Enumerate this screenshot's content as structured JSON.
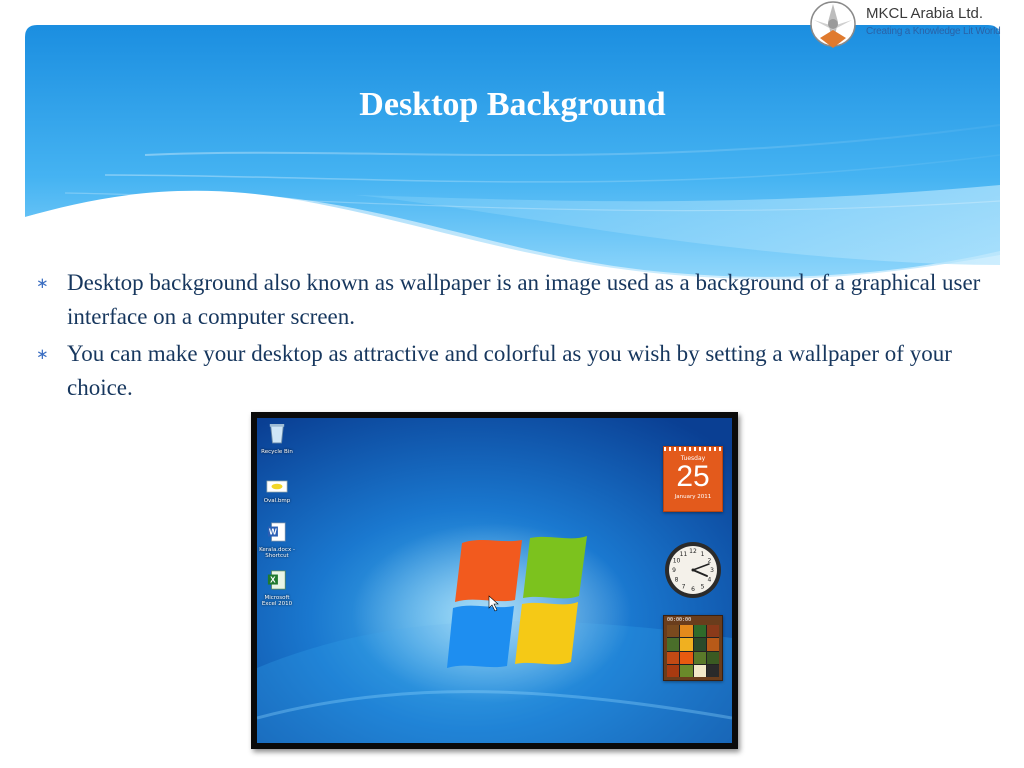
{
  "slide": {
    "title": "Desktop Background"
  },
  "logo": {
    "name": "MKCL Arabia Ltd.",
    "tagline": "Creating a Knowledge Lit World"
  },
  "bullets": [
    {
      "text": "Desktop background also known as wallpaper is an image used as a background of a graphical user interface on a computer screen."
    },
    {
      "text": "You can make your desktop as attractive and colorful as you wish by setting a wallpaper of your choice."
    }
  ],
  "screenshot": {
    "desktop_icons": [
      {
        "label": "Recycle Bin",
        "icon": "recycle-bin-icon"
      },
      {
        "label": "Oval.bmp",
        "icon": "bitmap-file-icon"
      },
      {
        "label": "Kerala.docx - Shortcut",
        "icon": "word-document-icon"
      },
      {
        "label": "Microsoft Excel 2010",
        "icon": "excel-icon"
      }
    ],
    "calendar": {
      "weekday": "Tuesday",
      "day": "25",
      "month_year": "January 2011"
    },
    "clock": {
      "numerals": [
        "12",
        "1",
        "2",
        "3",
        "4",
        "5",
        "6",
        "7",
        "8",
        "9",
        "10",
        "11"
      ]
    },
    "puzzle": {
      "timer": "00:00:00"
    }
  },
  "colors": {
    "banner_blue": "#1a8fe0",
    "bullet_text": "#17375e",
    "bullet_mark": "#3b6ec2",
    "calendar_orange": "#e35a1c"
  }
}
